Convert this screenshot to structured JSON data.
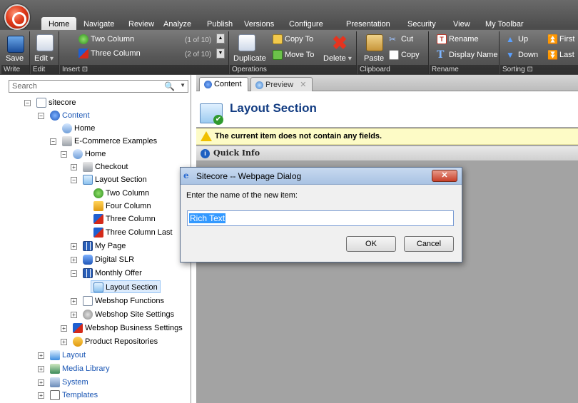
{
  "ribbon": {
    "tabs": [
      "Home",
      "Navigate",
      "Review",
      "Analyze",
      "Publish",
      "Versions",
      "Configure",
      "Presentation",
      "Security",
      "View",
      "My Toolbar"
    ],
    "groups": {
      "write": {
        "label": "Write",
        "save": "Save"
      },
      "edit": {
        "label": "Edit",
        "edit": "Edit"
      },
      "insert": {
        "label": "Insert",
        "items": [
          {
            "label": "Two Column",
            "count": "(1 of 10)"
          },
          {
            "label": "Three Column",
            "count": "(2 of 10)"
          }
        ]
      },
      "operations": {
        "label": "Operations",
        "duplicate": "Duplicate",
        "copy_to": "Copy To",
        "move_to": "Move To",
        "delete": "Delete"
      },
      "clipboard": {
        "label": "Clipboard",
        "paste": "Paste",
        "cut": "Cut",
        "copy": "Copy"
      },
      "rename": {
        "label": "Rename",
        "rename": "Rename",
        "display_name": "Display Name"
      },
      "sorting": {
        "label": "Sorting",
        "up": "Up",
        "down": "Down",
        "first": "First",
        "last": "Last"
      }
    }
  },
  "search": {
    "placeholder": "Search"
  },
  "tree": [
    {
      "label": "sitecore"
    },
    {
      "label": "Content"
    },
    {
      "label": "Home"
    },
    {
      "label": "E-Commerce Examples"
    },
    {
      "label": "Home"
    },
    {
      "label": "Checkout"
    },
    {
      "label": "Layout Section"
    },
    {
      "label": "Two Column"
    },
    {
      "label": "Four Column"
    },
    {
      "label": "Three Column"
    },
    {
      "label": "Three Column Last"
    },
    {
      "label": "My Page"
    },
    {
      "label": "Digital SLR"
    },
    {
      "label": "Monthly Offer"
    },
    {
      "label": "Layout Section"
    },
    {
      "label": "Webshop Functions"
    },
    {
      "label": "Webshop Site Settings"
    },
    {
      "label": "Webshop Business Settings"
    },
    {
      "label": "Product Repositories"
    },
    {
      "label": "Layout"
    },
    {
      "label": "Media Library"
    },
    {
      "label": "System"
    },
    {
      "label": "Templates"
    }
  ],
  "content_tabs": [
    {
      "label": "Content"
    },
    {
      "label": "Preview"
    }
  ],
  "main": {
    "title": "Layout Section",
    "warning": "The current item does not contain any fields.",
    "quick_info": "Quick Info"
  },
  "dialog": {
    "title": "Sitecore -- Webpage Dialog",
    "prompt": "Enter the name of the new item:",
    "value": "Rich Text",
    "ok": "OK",
    "cancel": "Cancel"
  }
}
